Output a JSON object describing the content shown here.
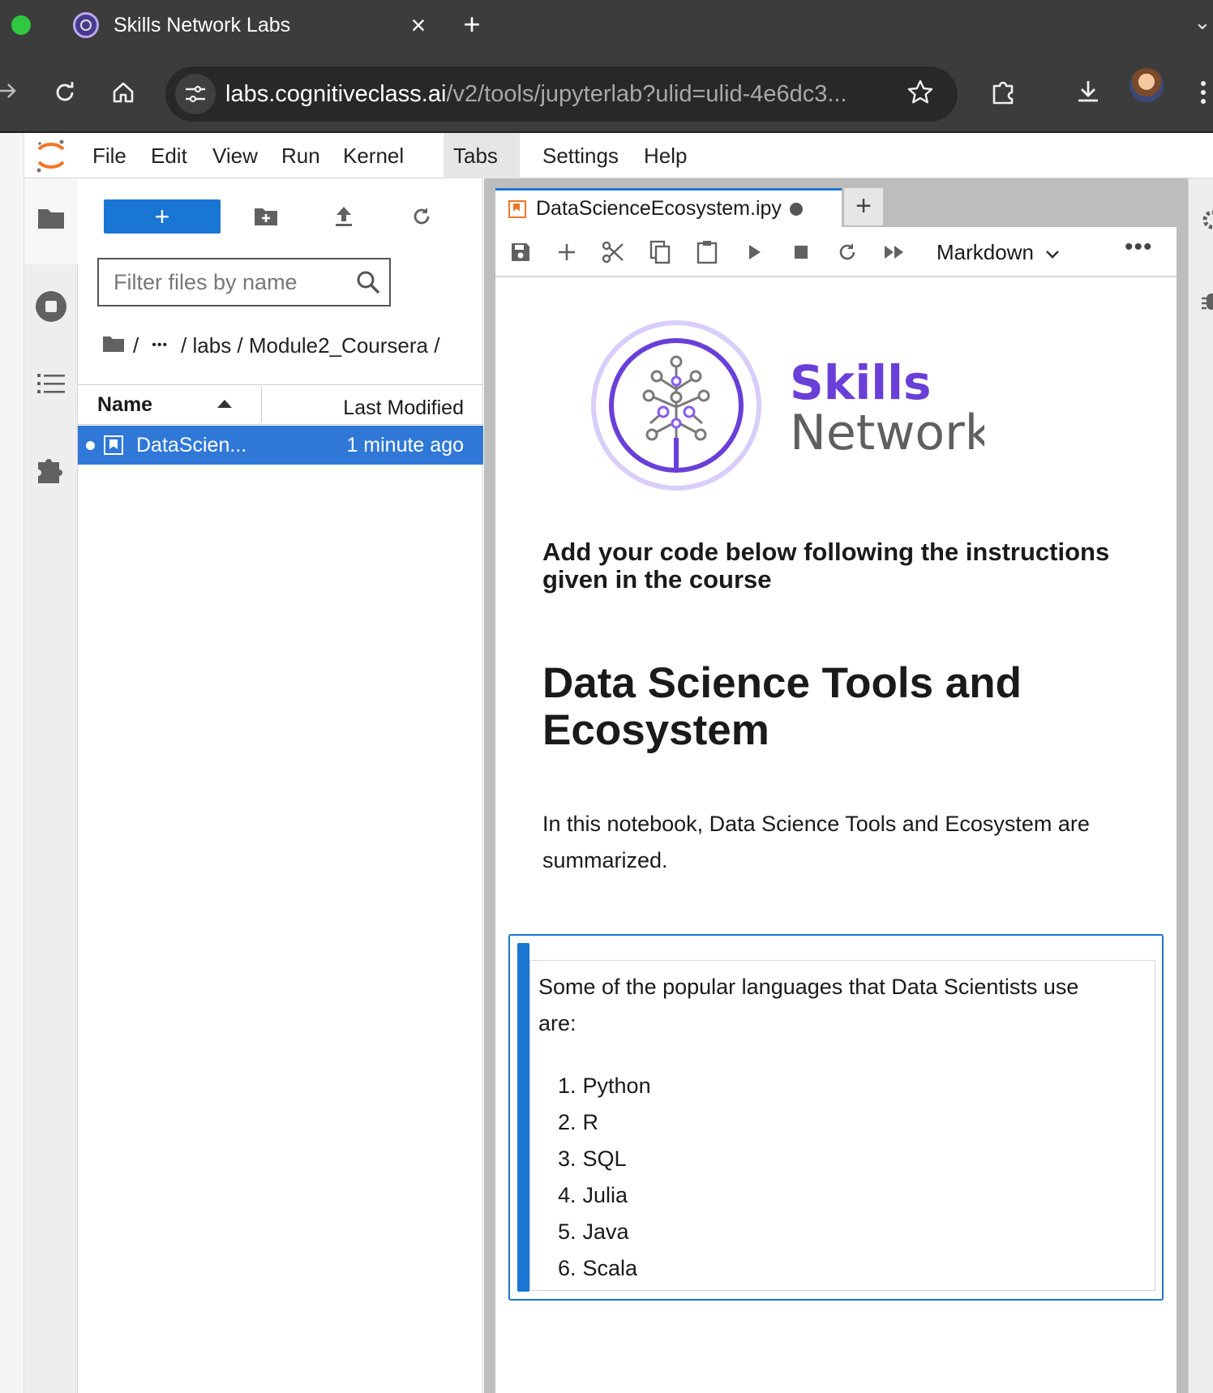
{
  "browser": {
    "tab_title": "Skills Network Labs",
    "tab_close": "×",
    "new_tab": "+",
    "url_host": "labs.cognitiveclass.ai",
    "url_path": "/v2/tools/jupyterlab?ulid=ulid-4e6dc3..."
  },
  "menubar": {
    "items": [
      "File",
      "Edit",
      "View",
      "Run",
      "Kernel",
      "Tabs",
      "Settings",
      "Help"
    ],
    "active": "Tabs"
  },
  "filebrowser": {
    "new_label": "+",
    "filter_placeholder": "Filter files by name",
    "crumbs": {
      "root_sep": "/",
      "ellipsis": "•••",
      "path": "/ labs / Module2_Coursera /"
    },
    "headers": {
      "name": "Name",
      "modified": "Last Modified"
    },
    "files": [
      {
        "name": "DataScien...",
        "modified": "1 minute ago",
        "selected": true
      }
    ]
  },
  "notebook": {
    "tab_label": "DataScienceEcosystem.ipy",
    "add_tab": "+",
    "cell_type": "Markdown",
    "more": "•••",
    "logo": {
      "skills": "Skills",
      "network": "Network"
    },
    "cells": {
      "instructions": "Add your code below following the instructions given in the course",
      "title": "Data Science Tools and Ecosystem",
      "intro": "In this notebook, Data Science Tools and Ecosystem are summarized.",
      "languages_intro": "Some of the popular languages that Data Scientists use are:",
      "languages": [
        "Python",
        "R",
        "SQL",
        "Julia",
        "Java",
        "Scala"
      ]
    }
  },
  "colors": {
    "browser_chrome": "#3c3c3c",
    "jupyter_blue": "#1976d2",
    "selection_blue": "#2f78d8",
    "skills_purple": "#6a3fd8",
    "network_gray": "#5f5f5f",
    "jupyter_orange": "#f37626"
  }
}
